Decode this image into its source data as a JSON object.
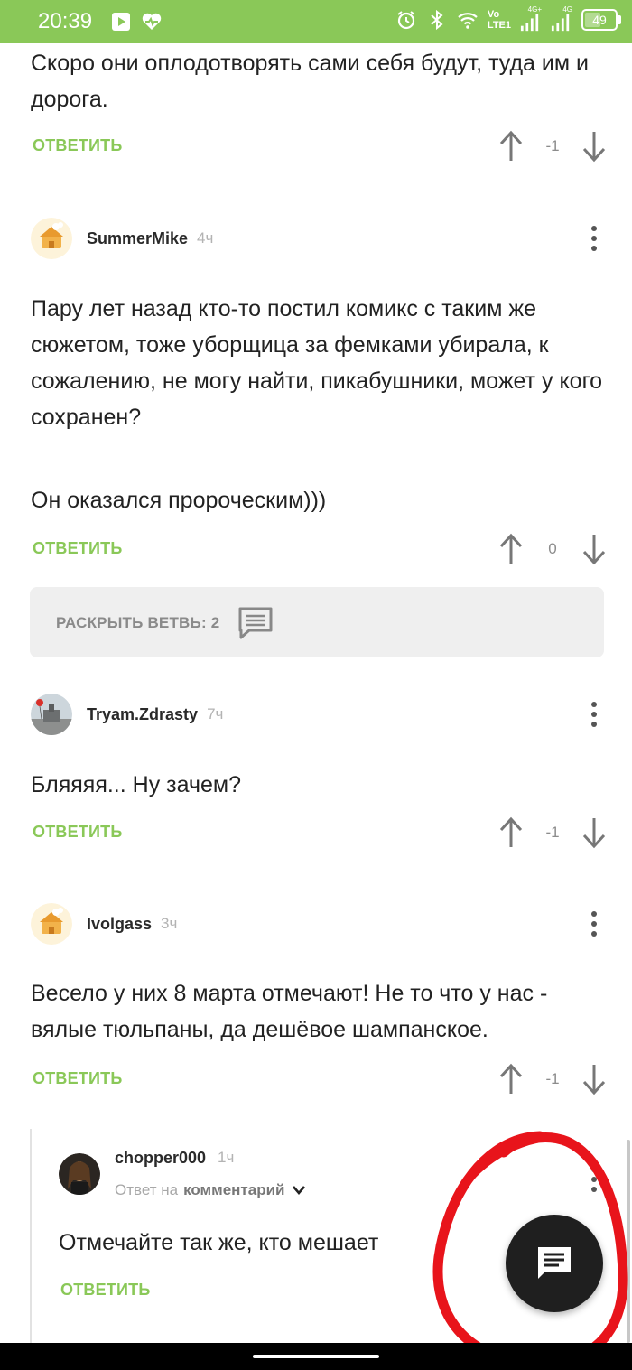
{
  "status_bar": {
    "time": "20:39",
    "network_label_top": "Vo",
    "network_label_bottom": "LTE1",
    "signal1_label": "4G+",
    "signal2_label": "4G",
    "battery": "49",
    "battery_level": 0.49
  },
  "colors": {
    "accent": "#8ac858",
    "fab": "#1f1f1f",
    "annotation": "#e8141b"
  },
  "comments": [
    {
      "text": "Скоро они оплодотворять сами себя будут, туда им и дорога.",
      "reply_label": "ОТВЕТИТЬ",
      "score": "-1"
    },
    {
      "author": "SummerMike",
      "time": "4ч",
      "text_p1": "Пару лет назад кто-то постил комикс с таким же сюжетом, тоже уборщица за фемками убирала, к сожалению, не могу найти, пикабушники, может у кого сохранен?",
      "text_p2": "Он оказался пророческим)))",
      "reply_label": "ОТВЕТИТЬ",
      "score": "0"
    },
    {
      "author": "Tryam.Zdrasty",
      "time": "7ч",
      "text": "Бляяяя... Ну зачем?",
      "reply_label": "ОТВЕТИТЬ",
      "score": "-1"
    },
    {
      "author": "Ivolgass",
      "time": "3ч",
      "text": "Весело у них 8 марта отмечают! Не то что у нас - вялые тюльпаны, да дешёвое шампанское.",
      "reply_label": "ОТВЕТИТЬ",
      "score": "-1"
    },
    {
      "author": "chopper000",
      "time": "1ч",
      "reply_to_prefix": "Ответ на",
      "reply_to_target": "комментарий",
      "text": "Отмечайте так же, кто мешает",
      "reply_label": "ОТВЕТИТЬ"
    }
  ],
  "branch": {
    "label": "РАСКРЫТЬ ВЕТВЬ: 2"
  }
}
